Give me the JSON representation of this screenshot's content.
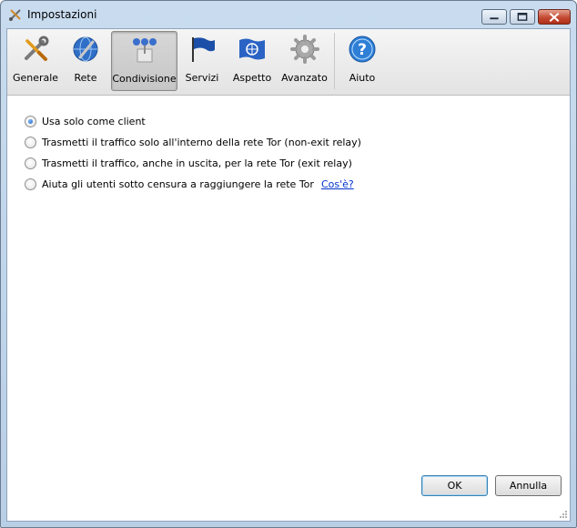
{
  "window": {
    "title": "Impostazioni",
    "icon": "tools-icon"
  },
  "titlebar_buttons": {
    "minimize": "minimize-icon",
    "maximize": "maximize-icon",
    "close": "close-icon"
  },
  "toolbar": {
    "items": [
      {
        "label": "Generale",
        "icon": "wrench-screwdriver-icon",
        "active": false
      },
      {
        "label": "Rete",
        "icon": "network-globe-icon",
        "active": false
      },
      {
        "label": "Condivisione",
        "icon": "share-relay-icon",
        "active": true
      },
      {
        "label": "Servizi",
        "icon": "flag-icon",
        "active": false
      },
      {
        "label": "Aspetto",
        "icon": "un-flag-icon",
        "active": false
      },
      {
        "label": "Avanzato",
        "icon": "gear-icon",
        "active": false
      },
      {
        "label": "Aiuto",
        "icon": "help-icon",
        "active": false
      }
    ]
  },
  "sharing": {
    "options": [
      {
        "label": "Usa solo come client",
        "checked": true
      },
      {
        "label": "Trasmetti il traffico solo all'interno della rete Tor (non-exit relay)",
        "checked": false
      },
      {
        "label": "Trasmetti il traffico, anche in uscita, per la rete Tor (exit relay)",
        "checked": false
      },
      {
        "label": "Aiuta gli utenti sotto censura a raggiungere la rete Tor",
        "checked": false,
        "link": "Cos'è?"
      }
    ]
  },
  "buttons": {
    "ok": "OK",
    "cancel": "Annulla"
  },
  "colors": {
    "title_bar": "#c9dcef",
    "close_button": "#c44a33",
    "link": "#0033cc",
    "radio_selected": "#1f5fbf"
  }
}
